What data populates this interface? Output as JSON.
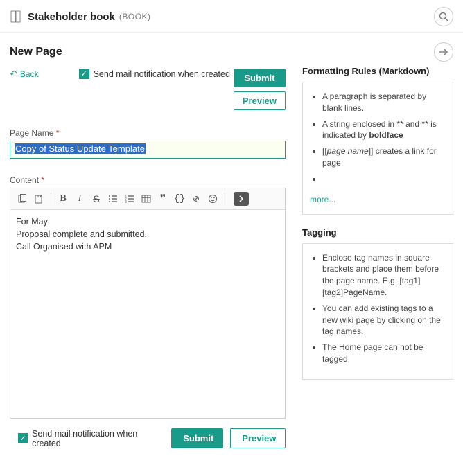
{
  "header": {
    "title": "Stakeholder book",
    "type": "(BOOK)"
  },
  "page": {
    "heading": "New Page",
    "back": "Back",
    "notify_label": "Send mail notification when created",
    "submit": "Submit",
    "preview": "Preview",
    "page_name_label": "Page Name",
    "page_name_value": "Copy of Status Update Template",
    "content_label": "Content",
    "content_value": "For May\nProposal complete and submitted.\nCall Organised with APM"
  },
  "help": {
    "formatting_title": "Formatting Rules (Markdown)",
    "formatting_items": {
      "a": "A paragraph is separated by blank lines.",
      "b1": "A string enclosed in ** and ** is indicated by ",
      "b2": "boldface",
      "c1": "[[",
      "c2": "page name",
      "c3": "]] creates a link for page"
    },
    "more": "more...",
    "tagging_title": "Tagging",
    "tagging_items": {
      "a": "Enclose tag names in square brackets and place them before the page name. E.g. [tag1][tag2]PageName.",
      "b": "You can add existing tags to a new wiki page by clicking on the tag names.",
      "c": "The Home page can not be tagged."
    }
  }
}
